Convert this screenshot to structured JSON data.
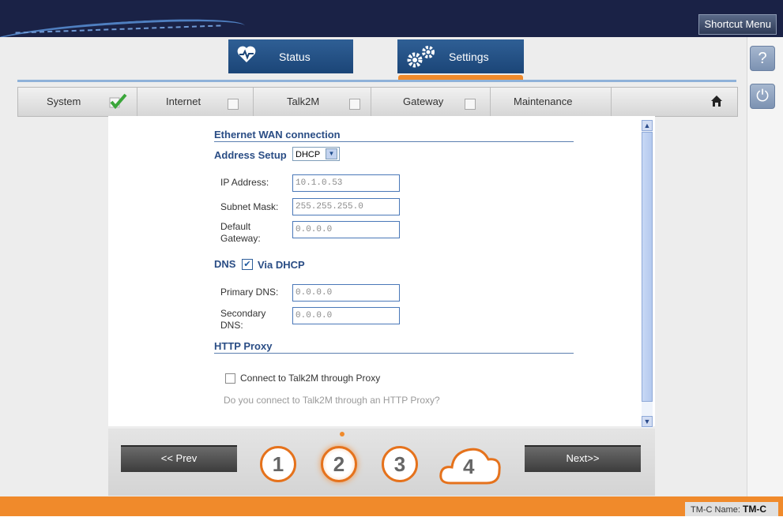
{
  "header": {
    "shortcut_menu": "Shortcut Menu"
  },
  "tabs": [
    {
      "label": "Status",
      "icon": "heart-pulse-icon"
    },
    {
      "label": "Settings",
      "icon": "gears-icon",
      "active": true
    }
  ],
  "side_buttons": [
    {
      "icon": "help-icon",
      "glyph": "?"
    },
    {
      "icon": "power-icon",
      "glyph": "⏻"
    }
  ],
  "wizard_nav": {
    "items": [
      {
        "label": "System",
        "checked": true
      },
      {
        "label": "Internet",
        "checked": false
      },
      {
        "label": "Talk2M",
        "checked": false
      },
      {
        "label": "Gateway",
        "checked": false
      },
      {
        "label": "Maintenance"
      }
    ],
    "home_icon": "home-icon"
  },
  "form": {
    "section_title": "Ethernet WAN connection",
    "address_setup_label": "Address Setup",
    "address_setup_value": "DHCP",
    "ip_label": "IP Address:",
    "ip_value": "10.1.0.53",
    "mask_label": "Subnet Mask:",
    "mask_value": "255.255.255.0",
    "gw_label_1": "Default",
    "gw_label_2": "Gateway:",
    "gw_value": "0.0.0.0",
    "dns_label": "DNS",
    "via_dhcp_label": "Via DHCP",
    "via_dhcp_checked": true,
    "pdns_label": "Primary DNS:",
    "pdns_value": "0.0.0.0",
    "sdns_label_1": "Secondary",
    "sdns_label_2": "DNS:",
    "sdns_value": "0.0.0.0",
    "proxy_title": "HTTP Proxy",
    "proxy_checkbox_label": "Connect to Talk2M through Proxy",
    "proxy_checked": false,
    "proxy_hint": "Do you connect to Talk2M through an HTTP Proxy?"
  },
  "wizard": {
    "prev_label": "<< Prev",
    "next_label": "Next>>",
    "steps": [
      "1",
      "2",
      "3",
      "4"
    ],
    "current_step": "2"
  },
  "footer": {
    "name_label": "TM-C Name:",
    "name_value": "TM-C"
  },
  "colors": {
    "accent_orange": "#f08a2b",
    "header_navy": "#1a2246",
    "tab_blue": "#1b4577",
    "section_blue": "#2a4d85"
  }
}
